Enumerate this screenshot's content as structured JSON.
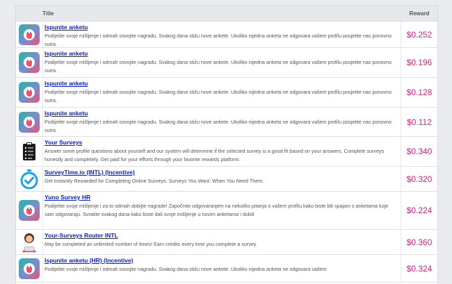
{
  "header": {
    "title": "Title",
    "reward": "Reward"
  },
  "offers": [
    {
      "icon": "survey-app-icon",
      "title": "Ispunite anketu",
      "description": "Podijelite svoje mišljenje i odmah osvojite nagradu. Svakog dana stižu nove ankete. Ukoliko nijedna anketa ne odgovara vašem profilu posjetite nas ponovno sutra.",
      "reward": "$0.252"
    },
    {
      "icon": "survey-app-icon",
      "title": "Ispunite anketu",
      "description": "Podijelite svoje mišljenje i odmah osvojite nagradu. Svakog dana stižu nove ankete. Ukoliko nijedna anketa ne odgovara vašem profilu posjetite nas ponovno sutra.",
      "reward": "$0.196"
    },
    {
      "icon": "survey-app-icon",
      "title": "Ispunite anketu",
      "description": "Podijelite svoje mišljenje i odmah osvojite nagradu. Svakog dana stižu nove ankete. Ukoliko nijedna anketa ne odgovara vašem profilu posjetite nas ponovno sutra.",
      "reward": "$0.128"
    },
    {
      "icon": "survey-app-icon",
      "title": "Ispunite anketu",
      "description": "Podijelite svoje mišljenje i odmah osvojite nagradu. Svakog dana stižu nove ankete. Ukoliko nijedna anketa ne odgovara vašem profilu posjetite nas ponovno sutra.",
      "reward": "$0.112"
    },
    {
      "icon": "clipboard-icon",
      "title": "Your Surveys",
      "description": "Answer some profile questions about yourself and our system will determine if the selected survey is a good fit based on your answers. Complete surveys honestly and completely. Get paid for your efforts through your favorite rewards platform.",
      "reward": "$0.340"
    },
    {
      "icon": "stopwatch-check-icon",
      "title": "SurveyTime.io (INTL) (Incentive)",
      "description": "Get Instantly Rewarded for Completing Online Surveys. Surveys You Want. When You Need Them.",
      "reward": "$0.320"
    },
    {
      "icon": "survey-app-icon",
      "title": "Yuno Survey HR",
      "description": "Podijelite svoje mišljenje i za to odmah dobijte nagrade! Započnite odgovaranjem na nekoliko pitanja o vašem profilu kako biste bili spajani s anketama koje vam odgovaraju. Svratite svakog dana kako biste dali svoje mišljenje u novim anketama i dobili",
      "reward": "$0.224"
    },
    {
      "icon": "woman-laptop-icon",
      "title": "Your-Surveys Router INTL",
      "description": "May be completed an unlimited number of times! Earn credits every time you complete a survey.",
      "reward": "$0.360"
    },
    {
      "icon": "survey-app-icon",
      "title": "Ispunite anketu (HR) (Incentive)",
      "description": "Podijelite svoje mišljenje i odmah osvojite nagradu. Svakog dana stižu nove ankete. Ukoliko nijedna anketa ne odgovara vašem",
      "reward": "$0.324"
    }
  ],
  "colors": {
    "link": "#0b20c8",
    "reward": "#d0257a",
    "brand_gradient_start": "#20b8a8",
    "brand_gradient_end": "#f0506e"
  }
}
